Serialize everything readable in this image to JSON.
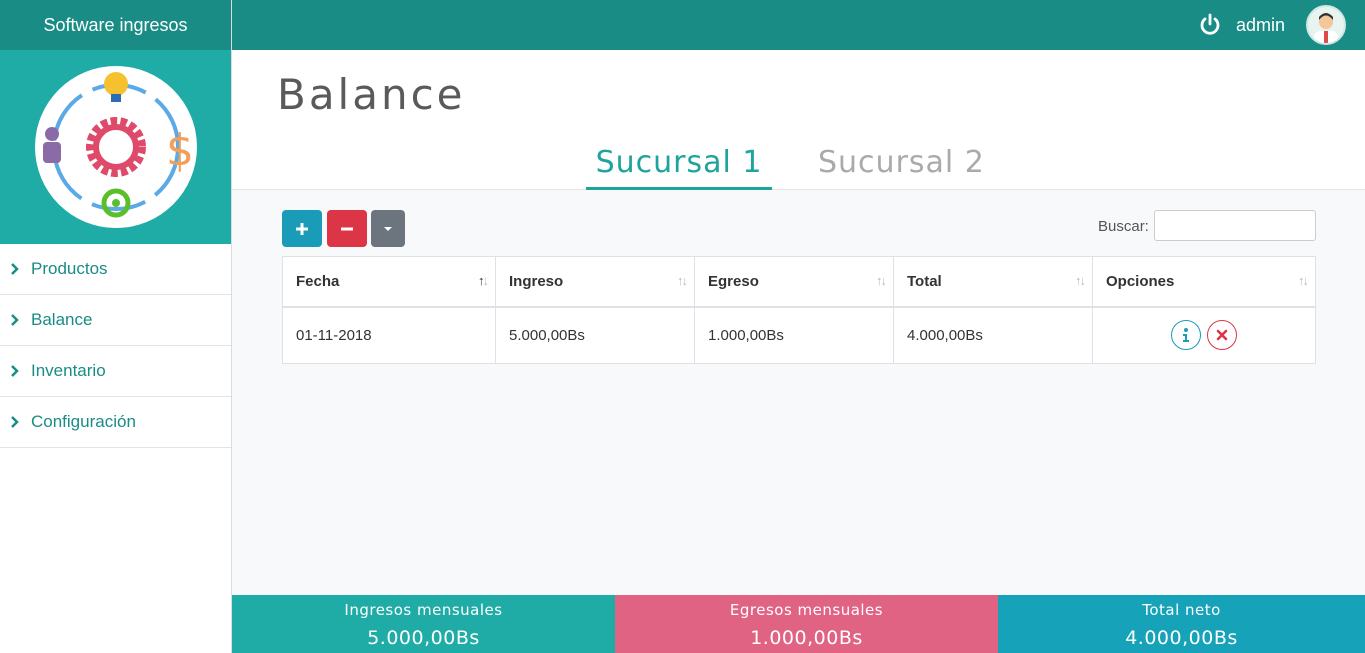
{
  "app": {
    "title": "Software ingresos"
  },
  "sidebar": {
    "items": [
      {
        "label": "Productos"
      },
      {
        "label": "Balance"
      },
      {
        "label": "Inventario"
      },
      {
        "label": "Configuración"
      }
    ]
  },
  "topbar": {
    "user": "admin"
  },
  "page": {
    "title": "Balance"
  },
  "tabs": [
    {
      "label": "Sucursal 1",
      "active": true
    },
    {
      "label": "Sucursal 2",
      "active": false
    }
  ],
  "toolbar": {
    "search_label": "Buscar:",
    "search_value": ""
  },
  "table": {
    "headers": [
      "Fecha",
      "Ingreso",
      "Egreso",
      "Total",
      "Opciones"
    ],
    "rows": [
      {
        "fecha": "01-11-2018",
        "ingreso": "5.000,00Bs",
        "egreso": "1.000,00Bs",
        "total": "4.000,00Bs"
      }
    ]
  },
  "summary": {
    "ingresos": {
      "label": "Ingresos mensuales",
      "value": "5.000,00Bs"
    },
    "egresos": {
      "label": "Egresos mensuales",
      "value": "1.000,00Bs"
    },
    "neto": {
      "label": "Total neto",
      "value": "4.000,00Bs"
    }
  },
  "colors": {
    "primary": "#1a8c86",
    "teal": "#20aca6",
    "pink": "#e06383",
    "cyan": "#16a2b8",
    "danger": "#dc3545"
  }
}
